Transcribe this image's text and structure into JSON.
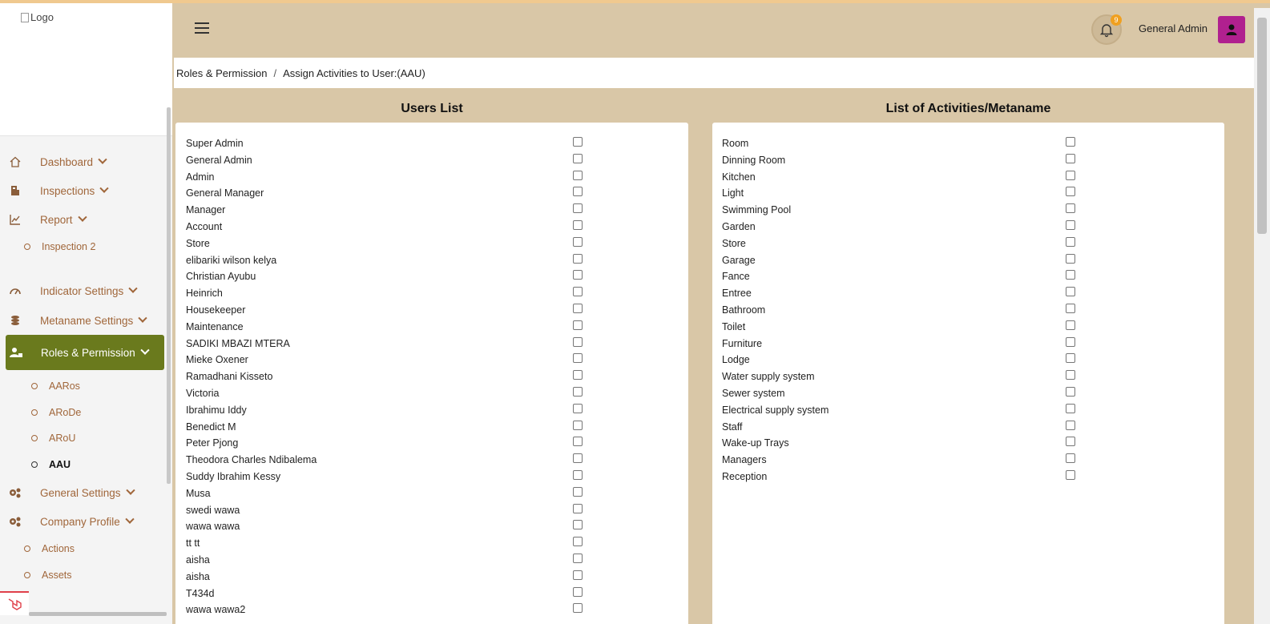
{
  "sidebar": {
    "logo_alt": "Logo",
    "nav": [
      {
        "label": "Dashboard",
        "icon": "home-icon"
      },
      {
        "label": "Inspections",
        "icon": "building-icon"
      },
      {
        "label": "Report",
        "icon": "chart-icon"
      },
      {
        "label": "Indicator Settings",
        "icon": "gauge-icon"
      },
      {
        "label": "Metaname Settings",
        "icon": "coins-icon"
      },
      {
        "label": "Roles & Permission",
        "icon": "user-lock-icon"
      },
      {
        "label": "General Settings",
        "icon": "cogs-icon"
      },
      {
        "label": "Company Profile",
        "icon": "cogs-icon"
      }
    ],
    "report_sub": [
      "Inspection 2"
    ],
    "roles_sub": [
      "AARos",
      "ARoDe",
      "ARoU",
      "AAU"
    ],
    "company_sub": [
      "Actions",
      "Assets"
    ]
  },
  "header": {
    "notification_count": "9",
    "user_name": "General Admin"
  },
  "breadcrumb": {
    "parent": "Roles & Permission",
    "separator": "/",
    "current": "Assign Activities to User:(AAU)"
  },
  "users_panel": {
    "title": "Users List",
    "users": [
      "Super Admin",
      "General Admin",
      "Admin",
      "General Manager",
      "Manager",
      "Account",
      "Store",
      "elibariki wilson kelya",
      "Christian Ayubu",
      "Heinrich",
      "Housekeeper",
      "Maintenance",
      "SADIKI MBAZI MTERA",
      "Mieke Oxener",
      "Ramadhani Kisseto",
      "Victoria",
      "Ibrahimu Iddy",
      "Benedict M",
      "Peter Pjong",
      "Theodora Charles Ndibalema",
      "Suddy Ibrahim Kessy",
      "Musa",
      "swedi wawa",
      "wawa wawa",
      "tt tt",
      "aisha",
      "aisha",
      "T434d",
      "wawa wawa2"
    ]
  },
  "activities_panel": {
    "title": "List of Activities/Metaname",
    "activities": [
      "Room",
      "Dinning Room",
      "Kitchen",
      "Light",
      "Swimming Pool",
      "Garden",
      "Store",
      "Garage",
      "Fance",
      "Entree",
      "Bathroom",
      "Toilet",
      "Furniture",
      "Lodge",
      "Water supply system",
      "Sewer system",
      "Electrical supply system",
      "Staff",
      "Wake-up Trays",
      "Managers",
      "Reception"
    ]
  },
  "colors": {
    "header_bg": "#d9c7a7",
    "active_nav": "#6a7a1d",
    "avatar_bg": "#b0208f",
    "nav_text": "#a0663a"
  }
}
